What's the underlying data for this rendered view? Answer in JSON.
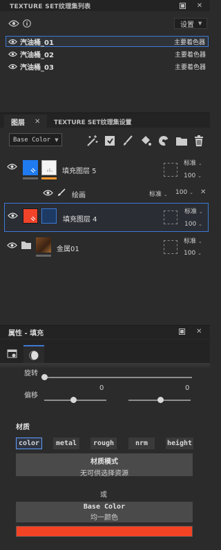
{
  "texture_set_list": {
    "title": "TEXTURE SET纹理集列表",
    "settings_label": "设置",
    "items": [
      {
        "name": "汽油桶_01",
        "shader": "主要着色器",
        "selected": true
      },
      {
        "name": "汽油桶_02",
        "shader": "主要着色器",
        "selected": false
      },
      {
        "name": "汽油桶_03",
        "shader": "主要着色器",
        "selected": false
      }
    ]
  },
  "layers_panel": {
    "tab_layers": "图层",
    "tab_texture_settings": "TEXTURE SET纹理集设置",
    "channel_select": "Base Color",
    "layers": [
      {
        "name": "填充图层 5",
        "blend": "标准",
        "opacity": "100",
        "mask_color": "#ff9a2e",
        "thumb_color": "#1f7bf0"
      },
      {
        "name": "绘画",
        "blend": "标准",
        "opacity": "100",
        "sub": true
      },
      {
        "name": "填充图层 4",
        "blend": "标准",
        "opacity": "100",
        "selected": true,
        "thumb_color": "#f0432a"
      },
      {
        "name": "金属01",
        "blend": "标准",
        "opacity": "100",
        "folder": true
      }
    ]
  },
  "properties": {
    "title": "属性 - 填充",
    "rotation_label": "旋转",
    "offset_label": "偏移",
    "offset_x": "0",
    "offset_y": "0",
    "material_label": "材质",
    "material_buttons": [
      "color",
      "metal",
      "rough",
      "nrm",
      "height"
    ],
    "material_mode_title": "材质模式",
    "material_mode_sub": "无可供选择资源",
    "or_label": "或",
    "base_color_title": "Base Color",
    "base_color_sub": "均一颜色",
    "base_color_swatch": "#f24325"
  }
}
